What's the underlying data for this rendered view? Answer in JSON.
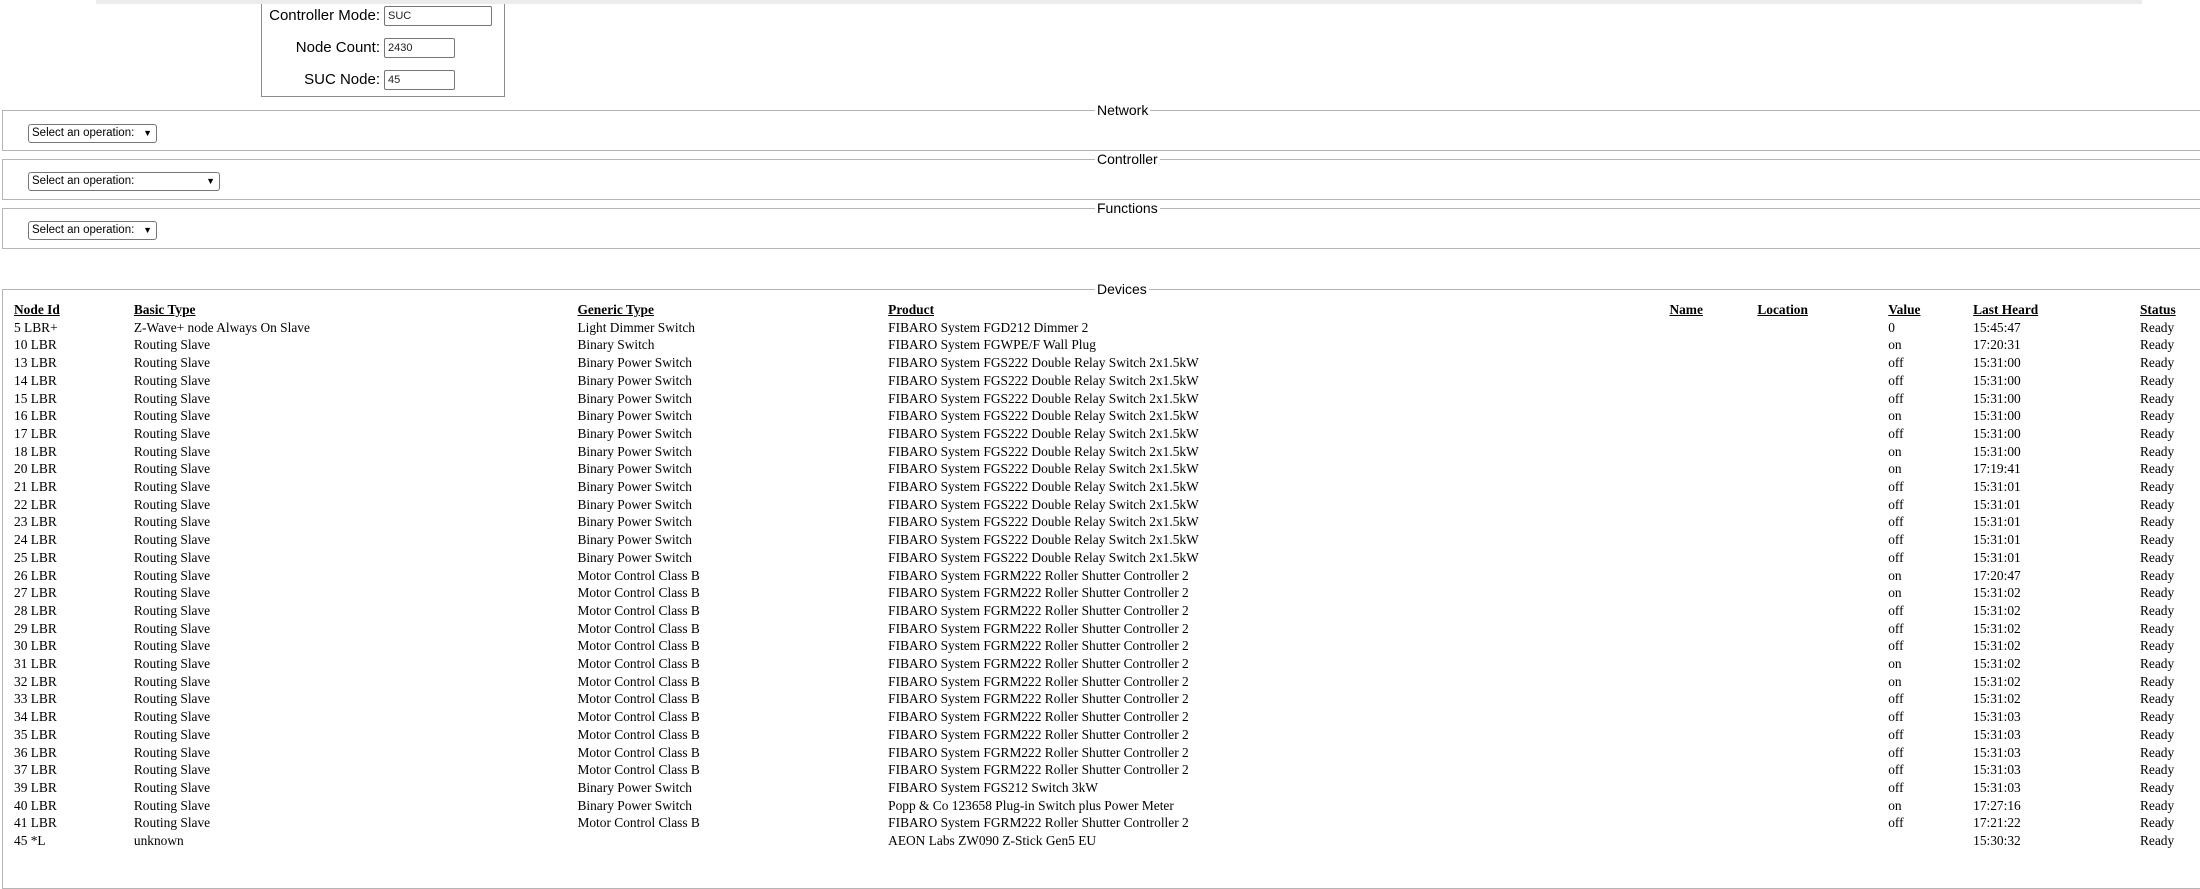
{
  "controller": {
    "mode_label": "Controller Mode:",
    "mode_value": "SUC",
    "node_count_label": "Node Count:",
    "node_count_value": "2430",
    "suc_node_label": "SUC Node:",
    "suc_node_value": "45"
  },
  "network": {
    "legend": "Network",
    "select": "Select an operation:"
  },
  "controller_ops": {
    "legend": "Controller",
    "select": "Select an operation:"
  },
  "functions": {
    "legend": "Functions",
    "select": "Select an operation:"
  },
  "devices": {
    "legend": "Devices",
    "headers": [
      "Node Id",
      "Basic Type",
      "Generic Type",
      "Product",
      "Name",
      "Location",
      "Value",
      "Last Heard",
      "Status"
    ],
    "rows": [
      [
        "5 LBR+",
        "Z-Wave+ node Always On Slave",
        "Light Dimmer Switch",
        "FIBARO System FGD212 Dimmer 2",
        "",
        "",
        "0",
        "15:45:47",
        "Ready"
      ],
      [
        "10 LBR",
        "Routing Slave",
        "Binary Switch",
        "FIBARO System FGWPE/F Wall Plug",
        "",
        "",
        "on",
        "17:20:31",
        "Ready"
      ],
      [
        "13 LBR",
        "Routing Slave",
        "Binary Power Switch",
        "FIBARO System FGS222 Double Relay Switch 2x1.5kW",
        "",
        "",
        "off",
        "15:31:00",
        "Ready"
      ],
      [
        "14 LBR",
        "Routing Slave",
        "Binary Power Switch",
        "FIBARO System FGS222 Double Relay Switch 2x1.5kW",
        "",
        "",
        "off",
        "15:31:00",
        "Ready"
      ],
      [
        "15 LBR",
        "Routing Slave",
        "Binary Power Switch",
        "FIBARO System FGS222 Double Relay Switch 2x1.5kW",
        "",
        "",
        "off",
        "15:31:00",
        "Ready"
      ],
      [
        "16 LBR",
        "Routing Slave",
        "Binary Power Switch",
        "FIBARO System FGS222 Double Relay Switch 2x1.5kW",
        "",
        "",
        "on",
        "15:31:00",
        "Ready"
      ],
      [
        "17 LBR",
        "Routing Slave",
        "Binary Power Switch",
        "FIBARO System FGS222 Double Relay Switch 2x1.5kW",
        "",
        "",
        "off",
        "15:31:00",
        "Ready"
      ],
      [
        "18 LBR",
        "Routing Slave",
        "Binary Power Switch",
        "FIBARO System FGS222 Double Relay Switch 2x1.5kW",
        "",
        "",
        "on",
        "15:31:00",
        "Ready"
      ],
      [
        "20 LBR",
        "Routing Slave",
        "Binary Power Switch",
        "FIBARO System FGS222 Double Relay Switch 2x1.5kW",
        "",
        "",
        "on",
        "17:19:41",
        "Ready"
      ],
      [
        "21 LBR",
        "Routing Slave",
        "Binary Power Switch",
        "FIBARO System FGS222 Double Relay Switch 2x1.5kW",
        "",
        "",
        "off",
        "15:31:01",
        "Ready"
      ],
      [
        "22 LBR",
        "Routing Slave",
        "Binary Power Switch",
        "FIBARO System FGS222 Double Relay Switch 2x1.5kW",
        "",
        "",
        "off",
        "15:31:01",
        "Ready"
      ],
      [
        "23 LBR",
        "Routing Slave",
        "Binary Power Switch",
        "FIBARO System FGS222 Double Relay Switch 2x1.5kW",
        "",
        "",
        "off",
        "15:31:01",
        "Ready"
      ],
      [
        "24 LBR",
        "Routing Slave",
        "Binary Power Switch",
        "FIBARO System FGS222 Double Relay Switch 2x1.5kW",
        "",
        "",
        "off",
        "15:31:01",
        "Ready"
      ],
      [
        "25 LBR",
        "Routing Slave",
        "Binary Power Switch",
        "FIBARO System FGS222 Double Relay Switch 2x1.5kW",
        "",
        "",
        "off",
        "15:31:01",
        "Ready"
      ],
      [
        "26 LBR",
        "Routing Slave",
        "Motor Control Class B",
        "FIBARO System FGRM222 Roller Shutter Controller 2",
        "",
        "",
        "on",
        "17:20:47",
        "Ready"
      ],
      [
        "27 LBR",
        "Routing Slave",
        "Motor Control Class B",
        "FIBARO System FGRM222 Roller Shutter Controller 2",
        "",
        "",
        "on",
        "15:31:02",
        "Ready"
      ],
      [
        "28 LBR",
        "Routing Slave",
        "Motor Control Class B",
        "FIBARO System FGRM222 Roller Shutter Controller 2",
        "",
        "",
        "off",
        "15:31:02",
        "Ready"
      ],
      [
        "29 LBR",
        "Routing Slave",
        "Motor Control Class B",
        "FIBARO System FGRM222 Roller Shutter Controller 2",
        "",
        "",
        "off",
        "15:31:02",
        "Ready"
      ],
      [
        "30 LBR",
        "Routing Slave",
        "Motor Control Class B",
        "FIBARO System FGRM222 Roller Shutter Controller 2",
        "",
        "",
        "off",
        "15:31:02",
        "Ready"
      ],
      [
        "31 LBR",
        "Routing Slave",
        "Motor Control Class B",
        "FIBARO System FGRM222 Roller Shutter Controller 2",
        "",
        "",
        "on",
        "15:31:02",
        "Ready"
      ],
      [
        "32 LBR",
        "Routing Slave",
        "Motor Control Class B",
        "FIBARO System FGRM222 Roller Shutter Controller 2",
        "",
        "",
        "on",
        "15:31:02",
        "Ready"
      ],
      [
        "33 LBR",
        "Routing Slave",
        "Motor Control Class B",
        "FIBARO System FGRM222 Roller Shutter Controller 2",
        "",
        "",
        "off",
        "15:31:02",
        "Ready"
      ],
      [
        "34 LBR",
        "Routing Slave",
        "Motor Control Class B",
        "FIBARO System FGRM222 Roller Shutter Controller 2",
        "",
        "",
        "off",
        "15:31:03",
        "Ready"
      ],
      [
        "35 LBR",
        "Routing Slave",
        "Motor Control Class B",
        "FIBARO System FGRM222 Roller Shutter Controller 2",
        "",
        "",
        "off",
        "15:31:03",
        "Ready"
      ],
      [
        "36 LBR",
        "Routing Slave",
        "Motor Control Class B",
        "FIBARO System FGRM222 Roller Shutter Controller 2",
        "",
        "",
        "off",
        "15:31:03",
        "Ready"
      ],
      [
        "37 LBR",
        "Routing Slave",
        "Motor Control Class B",
        "FIBARO System FGRM222 Roller Shutter Controller 2",
        "",
        "",
        "off",
        "15:31:03",
        "Ready"
      ],
      [
        "39 LBR",
        "Routing Slave",
        "Binary Power Switch",
        "FIBARO System FGS212 Switch 3kW",
        "",
        "",
        "off",
        "15:31:03",
        "Ready"
      ],
      [
        "40 LBR",
        "Routing Slave",
        "Binary Power Switch",
        "Popp & Co 123658 Plug-in Switch plus Power Meter",
        "",
        "",
        "on",
        "17:27:16",
        "Ready"
      ],
      [
        "41 LBR",
        "Routing Slave",
        "Motor Control Class B",
        "FIBARO System FGRM222 Roller Shutter Controller 2",
        "",
        "",
        "off",
        "17:21:22",
        "Ready"
      ],
      [
        "45 *L",
        "unknown",
        "",
        "AEON Labs ZW090 Z-Stick Gen5 EU",
        "",
        "",
        "",
        "15:30:32",
        "Ready"
      ]
    ]
  }
}
